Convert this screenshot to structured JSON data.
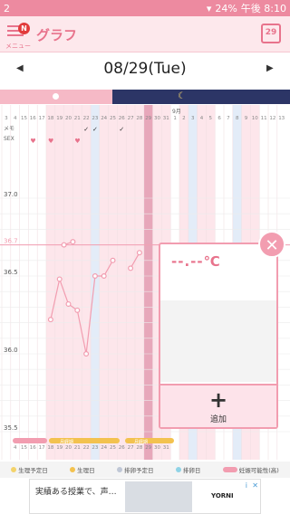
{
  "status": {
    "notification_count": "2",
    "battery": "24%",
    "time": "午後 8:10"
  },
  "header": {
    "menu_label": "メニュー",
    "badge": "N",
    "title": "グラフ",
    "calendar_day": "29"
  },
  "datebar": {
    "date": "08/29(Tue)",
    "prev_label": "◀",
    "next_label": "▶"
  },
  "chart": {
    "month_label": "9月",
    "day_labels": [
      "3",
      "4",
      "15",
      "16",
      "17",
      "18",
      "19",
      "20",
      "21",
      "22",
      "23",
      "24",
      "25",
      "26",
      "27",
      "28",
      "29",
      "30",
      "31",
      "1",
      "2",
      "3",
      "4",
      "5",
      "6",
      "7",
      "8",
      "9",
      "10",
      "11",
      "12",
      "13"
    ],
    "bottom_day_labels": [
      "4",
      "15",
      "16",
      "17",
      "18",
      "19",
      "20",
      "21",
      "22",
      "23",
      "24",
      "25",
      "26",
      "27",
      "28",
      "29",
      "30",
      "31"
    ],
    "memo_label": "メモ",
    "sex_label": "SEX",
    "y_labels": [
      "37.0",
      "36.7",
      "36.5",
      "36.0",
      "35.5"
    ],
    "bottom_band_labels": [
      "月経期",
      "月経期"
    ]
  },
  "chart_data": {
    "type": "line",
    "xlabel": "",
    "ylabel": "",
    "ylim": [
      35.5,
      37.0
    ],
    "cover_line": 36.7,
    "x": [
      "18",
      "19",
      "20",
      "21",
      "22",
      "23",
      "24",
      "25",
      "27",
      "28"
    ],
    "series": [
      {
        "segment": 1,
        "x": [
          "18",
          "19",
          "20",
          "21",
          "22",
          "23",
          "24",
          "25"
        ],
        "values": [
          36.22,
          36.48,
          36.32,
          36.28,
          36.0,
          36.5,
          36.5,
          36.6
        ]
      },
      {
        "segment": 2,
        "x": [
          "24",
          "25"
        ],
        "values": [
          36.7,
          36.72
        ]
      },
      {
        "segment": 3,
        "x": [
          "27",
          "28"
        ],
        "values": [
          36.55,
          36.65
        ]
      }
    ]
  },
  "popup": {
    "temperature": "--.--℃",
    "add_label": "追加",
    "plus": "+",
    "close": "✕"
  },
  "legend": {
    "items": [
      {
        "label": "生理予定日",
        "color": "#f3d36b"
      },
      {
        "label": "生理日",
        "color": "#f3c24f"
      },
      {
        "label": "排卵予定日",
        "color": "#bfc7d6"
      },
      {
        "label": "排卵日",
        "color": "#8fd3e6"
      },
      {
        "label": "妊娠可能性(高)",
        "color": "#f29db0"
      }
    ]
  },
  "ad": {
    "text": "実績ある授業で、声…",
    "brand": "YORNI",
    "info": "i",
    "close": "✕"
  }
}
